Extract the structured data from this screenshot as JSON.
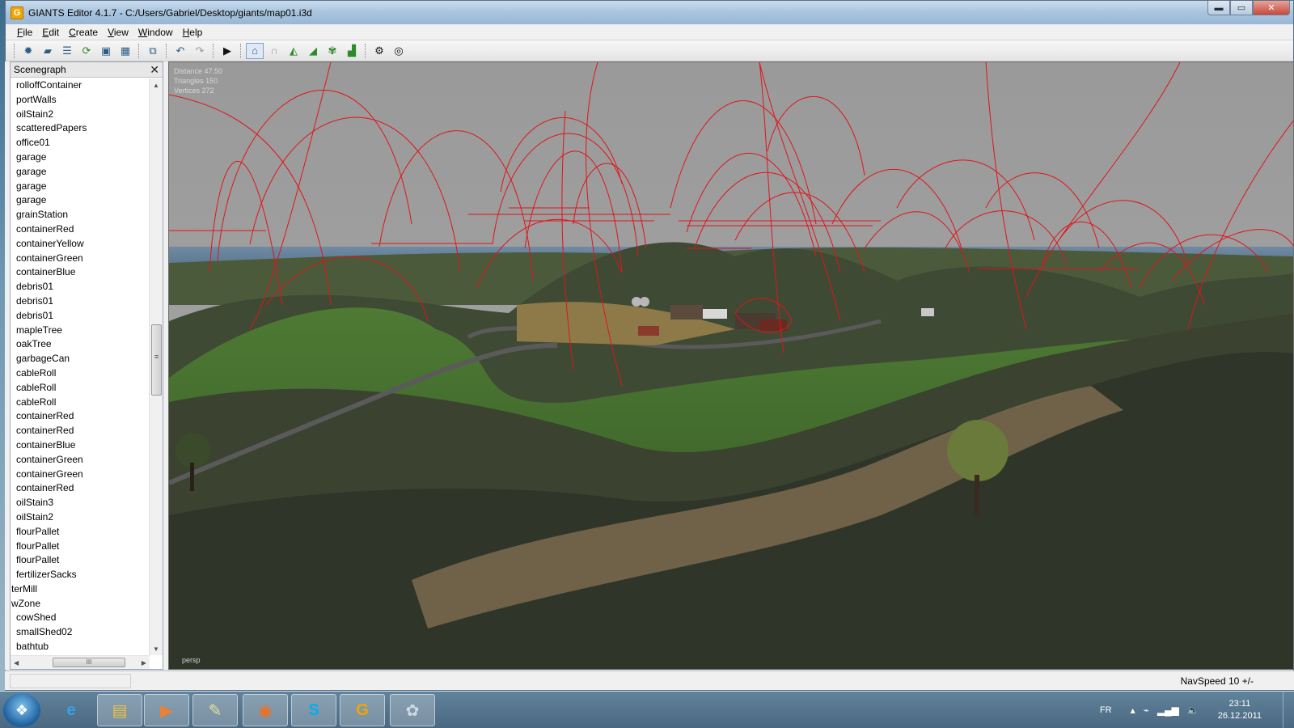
{
  "window": {
    "app_icon_glyph": "G",
    "title": "GIANTS Editor 4.1.7 - C:/Users/Gabriel/Desktop/giants/map01.i3d",
    "controls": {
      "minimize": "▬",
      "maximize": "▭",
      "close": "✕"
    }
  },
  "menu": [
    "File",
    "Edit",
    "Create",
    "View",
    "Window",
    "Help"
  ],
  "toolbar": {
    "icons": [
      "new-scene-icon",
      "open-icon",
      "import-icon",
      "reload-icon",
      "save-icon",
      "save-all-icon",
      "copy-icon",
      "undo-icon",
      "redo-icon",
      "play-icon",
      "select-move-icon",
      "magnet-icon",
      "terrain-sculpt-icon",
      "terrain-paint-icon",
      "foliage-paint-icon",
      "texture-paint-icon",
      "render-settings-icon",
      "camera-icon"
    ]
  },
  "scenegraph": {
    "title": "Scenegraph",
    "close_glyph": "✕",
    "items": [
      "rolloffContainer",
      "portWalls",
      "oilStain2",
      "scatteredPapers",
      "office01",
      "garage",
      "garage",
      "garage",
      "garage",
      "grainStation",
      "containerRed",
      "containerYellow",
      "containerGreen",
      "containerBlue",
      "debris01",
      "debris01",
      "debris01",
      "mapleTree",
      "oakTree",
      "garbageCan",
      "cableRoll",
      "cableRoll",
      "cableRoll",
      "containerRed",
      "containerRed",
      "containerBlue",
      "containerGreen",
      "containerGreen",
      "containerRed",
      "oilStain3",
      "oilStain2",
      "flourPallet",
      "flourPallet",
      "flourPallet",
      "fertilizerSacks",
      "terMill",
      "wZone",
      "cowShed",
      "smallShed02",
      "bathtub"
    ],
    "scroll_up": "▲",
    "scroll_down": "▼",
    "scroll_left": "◀",
    "scroll_right": "▶",
    "hthumb_grip": "III",
    "vthumb_grip": "≡"
  },
  "viewport": {
    "stats": [
      "Distance 47.50",
      "Triangles 150",
      "Vertices 272"
    ],
    "camera_label": "persp",
    "colors": {
      "sky": "#9c9c9c",
      "spline": "#e0141a",
      "grass": "#3f6a2a",
      "dirt": "#7a6a4e"
    }
  },
  "statusbar": {
    "navspeed": "NavSpeed 10 +/-"
  },
  "taskbar": {
    "start_glyph": "❖",
    "apps": [
      {
        "name": "ie-icon",
        "glyph": "e",
        "color": "#3aa0e8"
      },
      {
        "name": "explorer-icon",
        "glyph": "▤",
        "color": "#f0c040"
      },
      {
        "name": "media-player-icon",
        "glyph": "▶",
        "color": "#f08030"
      },
      {
        "name": "paint-icon",
        "glyph": "✎",
        "color": "#e8e0a0"
      },
      {
        "name": "firefox-icon",
        "glyph": "◉",
        "color": "#f07020"
      },
      {
        "name": "skype-icon",
        "glyph": "S",
        "color": "#00aff0"
      },
      {
        "name": "giants-editor-icon",
        "glyph": "G",
        "color": "#f2a500"
      },
      {
        "name": "mspaint-icon",
        "glyph": "✿",
        "color": "#d0d8e8"
      }
    ],
    "tray": {
      "language": "FR",
      "time": "23:11",
      "date": "26.12.2011"
    }
  }
}
